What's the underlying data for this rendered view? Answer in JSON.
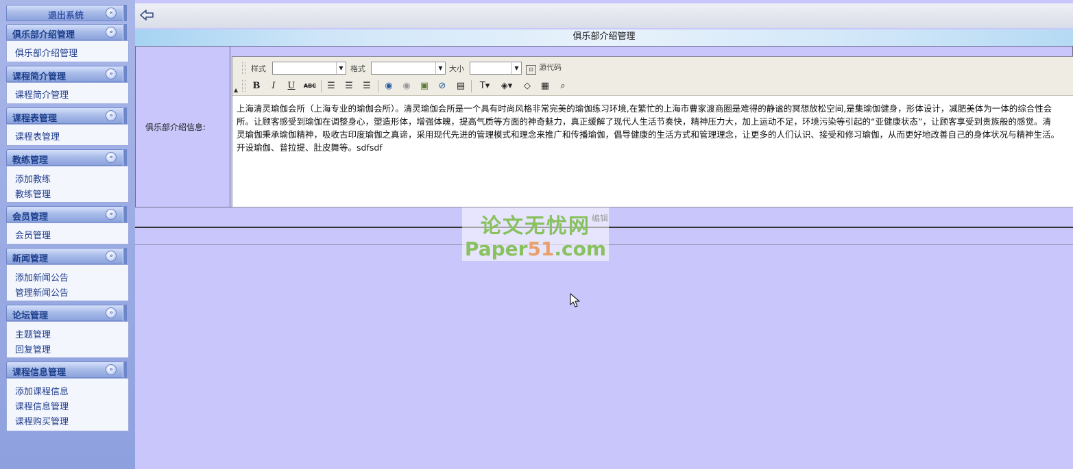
{
  "sidebar": {
    "exit": "退出系统",
    "groups": [
      {
        "title": "俱乐部介绍管理",
        "items": [
          "俱乐部介绍管理"
        ]
      },
      {
        "title": "课程简介管理",
        "items": [
          "课程简介管理"
        ]
      },
      {
        "title": "课程表管理",
        "items": [
          "课程表管理"
        ]
      },
      {
        "title": "教练管理",
        "items": [
          "添加教练",
          "教练管理"
        ]
      },
      {
        "title": "会员管理",
        "items": [
          "会员管理"
        ]
      },
      {
        "title": "新闻管理",
        "items": [
          "添加新闻公告",
          "管理新闻公告"
        ]
      },
      {
        "title": "论坛管理",
        "items": [
          "主题管理",
          "回复管理"
        ]
      },
      {
        "title": "课程信息管理",
        "items": [
          "添加课程信息",
          "课程信息管理",
          "课程购买管理"
        ]
      }
    ]
  },
  "page": {
    "title": "俱乐部介绍管理",
    "field_label": "俱乐部介绍信息:",
    "edit_button": "编辑"
  },
  "editor": {
    "style_label": "样式",
    "format_label": "格式",
    "size_label": "大小",
    "source_label": "源代码",
    "content": "上海清灵瑜伽会所（上海专业的瑜伽会所）。清灵瑜伽会所是一个具有时尚风格非常完美的瑜伽练习环境,在繁忙的上海市曹家渡商圈是难得的静谧的冥想放松空间,是集瑜伽健身，形体设计，减肥美体为一体的综合性会所。让顾客感受到瑜伽在调整身心，塑造形体，增强体魄，提高气质等方面的神奇魅力，真正缓解了现代人生活节奏快，精神压力大，加上运动不足，环境污染等引起的“亚健康状态”，让顾客享受到贵族般的感觉。清灵瑜伽秉承瑜伽精神，吸收古印度瑜伽之真谛，采用现代先进的管理模式和理念来推广和传播瑜伽，倡导健康的生活方式和管理理念，让更多的人们认识、接受和修习瑜伽，从而更好地改善自己的身体状况与精神生活。开设瑜伽、普拉提、肚皮舞等。sdfsdf"
  },
  "watermark": {
    "line1": "论文无忧网",
    "line2a": "Paper",
    "line2b": "51",
    "line2c": ".com"
  }
}
